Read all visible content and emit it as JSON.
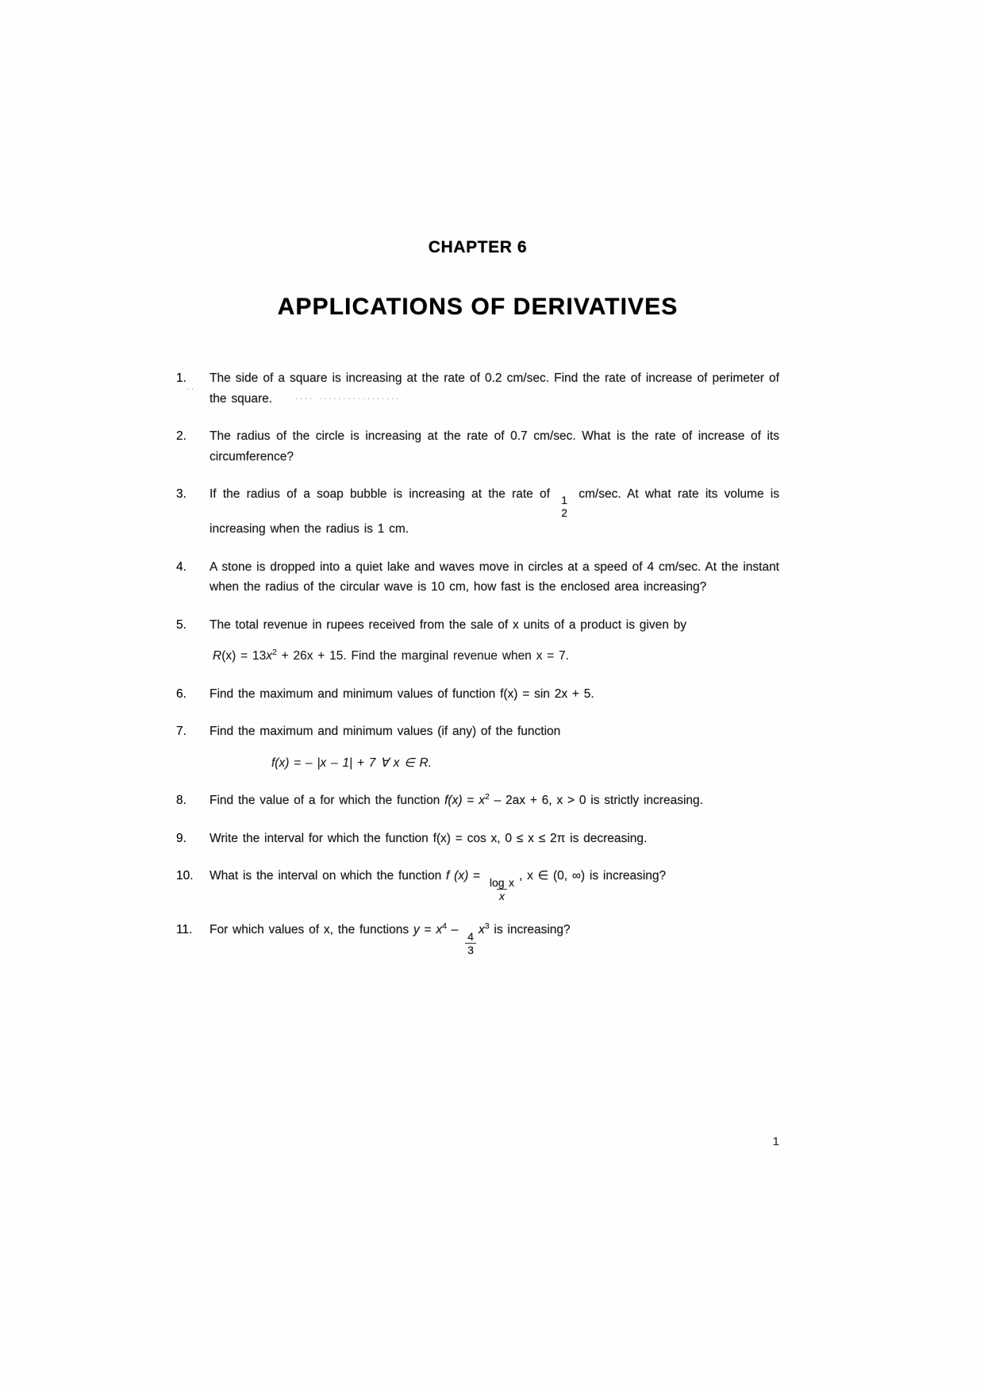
{
  "document": {
    "chapter_label": "CHAPTER 6",
    "chapter_title": "APPLICATIONS OF DERIVATIVES",
    "page_number": "1",
    "artifacts": {
      "dot_mark_a": "..",
      "dot_mark_b": ".... ................."
    }
  },
  "questions": [
    {
      "number": "1.",
      "text": "The side of a square is increasing at the rate of 0.2 cm/sec. Find the rate of increase of perimeter of the square."
    },
    {
      "number": "2.",
      "text": "The radius of the circle is increasing at the rate of 0.7 cm/sec. What is the rate of increase of its circumference?"
    },
    {
      "number": "3.",
      "lead": "If the radius of a soap bubble is increasing at the rate of",
      "fraction_numerator": "1",
      "fraction_denominator": "2",
      "tail": "cm/sec. At what rate its volume is increasing when the radius is 1 cm."
    },
    {
      "number": "4.",
      "text": "A stone is dropped into a quiet lake and waves move in circles at a speed of 4 cm/sec. At the instant when the radius of the circular wave is 10 cm, how fast is the enclosed area increasing?"
    },
    {
      "number": "5.",
      "text": "The total revenue in rupees received from the sale of x units of a product is given by",
      "formula_fn": "R",
      "formula_arg": "(x)",
      "formula_eq": " = 13",
      "formula_var": "x",
      "formula_exp": "2",
      "formula_rest": " + 26x + 15. Find the marginal revenue when x = 7."
    },
    {
      "number": "6.",
      "text": "Find the maximum and minimum values of function f(x) = sin 2x + 5."
    },
    {
      "number": "7.",
      "text": "Find the maximum and minimum values (if any) of the function",
      "formula": "f(x) = – |x – 1| + 7  ∀ x ∈ R."
    },
    {
      "number": "8.",
      "lead": "Find the value of a for which the function ",
      "fn": "f(x)",
      "eq": " = ",
      "var": "x",
      "exp": "2",
      "tail": " – 2ax + 6, x > 0 is strictly increasing."
    },
    {
      "number": "9.",
      "text": "Write the interval for which the function f(x) = cos x, 0 ≤ x ≤ 2π is decreasing."
    },
    {
      "number": "10.",
      "lead": "What is the interval on which the function ",
      "fn": "f (x)",
      "eq": " = ",
      "fraction_numerator": "log x",
      "fraction_denominator": "x",
      "tail": ", x ∈ (0, ∞) is increasing?"
    },
    {
      "number": "11.",
      "lead": "For which values of x, the functions ",
      "lhs": "y",
      "eq": " = ",
      "var1": "x",
      "exp1": "4",
      "minus": " – ",
      "fraction_numerator": "4",
      "fraction_denominator": "3",
      "var2": "x",
      "exp2": "3",
      "tail": " is increasing?"
    }
  ]
}
